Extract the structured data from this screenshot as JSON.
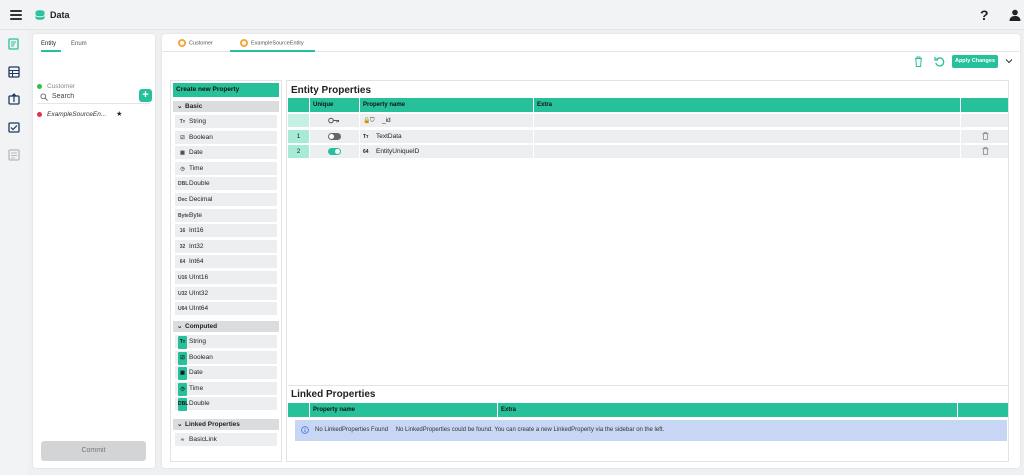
{
  "app": {
    "title": "Data"
  },
  "header": {
    "help_label": "?"
  },
  "left": {
    "tabs": [
      "Entity",
      "Enum"
    ],
    "search_placeholder": "Search",
    "add_label": "+",
    "entities": [
      {
        "name": "Customer",
        "color": "#2fbf4a",
        "starred": false
      },
      {
        "name": "ExampleSourceEn...",
        "color": "#e0334d",
        "starred": true
      }
    ],
    "star": "★",
    "commit_label": "Commit"
  },
  "tabs": [
    {
      "label": "Customer",
      "active": false
    },
    {
      "label": "ExampleSourceEntity",
      "active": true
    }
  ],
  "toolbar": {
    "apply_label": "Apply Changes"
  },
  "palette": {
    "title": "Create new Property",
    "basic_label": "Basic",
    "basic": [
      {
        "label": "String",
        "icon": "Tт"
      },
      {
        "label": "Boolean",
        "icon": "☑"
      },
      {
        "label": "Date",
        "icon": "▦"
      },
      {
        "label": "Time",
        "icon": "◷"
      },
      {
        "label": "Double",
        "icon": "DBL"
      },
      {
        "label": "Decimal",
        "icon": "Dec"
      },
      {
        "label": "Byte",
        "icon": "Byte"
      },
      {
        "label": "Int16",
        "icon": "16"
      },
      {
        "label": "Int32",
        "icon": "32"
      },
      {
        "label": "Int64",
        "icon": "64"
      },
      {
        "label": "UInt16",
        "icon": "U16"
      },
      {
        "label": "UInt32",
        "icon": "U32"
      },
      {
        "label": "UInt64",
        "icon": "U64"
      }
    ],
    "computed_label": "Computed",
    "computed": [
      {
        "label": "String",
        "icon": "Tт"
      },
      {
        "label": "Boolean",
        "icon": "☑"
      },
      {
        "label": "Date",
        "icon": "▦"
      },
      {
        "label": "Time",
        "icon": "◷"
      },
      {
        "label": "Double",
        "icon": "DBL"
      }
    ],
    "linked_label": "Linked Properties",
    "linked": [
      {
        "label": "BasicLink",
        "icon": "∞"
      }
    ]
  },
  "entity_props": {
    "title": "Entity Properties",
    "columns": [
      "Unique",
      "Property name",
      "Extra"
    ],
    "rows": [
      {
        "index": "",
        "unique": "key",
        "name": "_id",
        "type_icon": "🔒"
      },
      {
        "index": "1",
        "unique": "off",
        "name": "TextData",
        "type_icon": "Tт"
      },
      {
        "index": "2",
        "unique": "on",
        "name": "EntityUniqueID",
        "type_icon": "64"
      }
    ]
  },
  "linked_props": {
    "title": "Linked Properties",
    "columns": [
      "Property name",
      "Extra"
    ],
    "empty_title": "No LinkedProperties Found",
    "empty_text": "No LinkedProperties could be found. You can create a new LinkedProperty via the sidebar on the left."
  },
  "colors": {
    "accent": "#26c09a",
    "info_bg": "#c7d6f5"
  }
}
